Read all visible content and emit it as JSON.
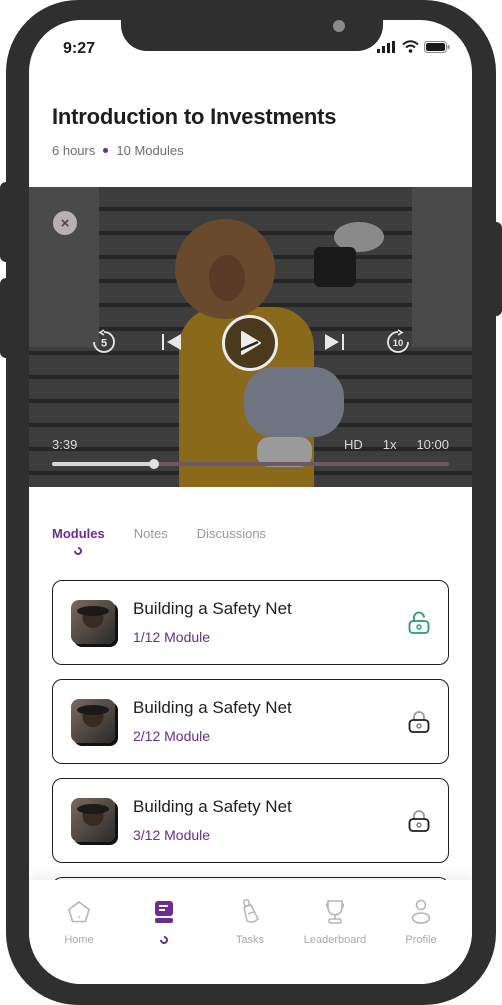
{
  "status_bar": {
    "time": "9:27",
    "icons": [
      "signal-icon",
      "wifi-icon",
      "battery-icon"
    ]
  },
  "course": {
    "title": "Introduction to Investments",
    "duration": "6 hours",
    "modules_count": "10 Modules"
  },
  "player": {
    "close_icon": "×",
    "rewind_label": "5",
    "forward_label": "10",
    "current_time": "3:39",
    "quality": "HD",
    "speed": "1x",
    "total_time": "10:00",
    "progress_fraction": 0.258
  },
  "tabs": [
    {
      "label": "Modules",
      "active": true
    },
    {
      "label": "Notes",
      "active": false
    },
    {
      "label": "Discussions",
      "active": false
    }
  ],
  "modules": [
    {
      "title": "Building a Safety Net",
      "subtitle": "1/12 Module",
      "lock_state": "unlocked"
    },
    {
      "title": "Building a Safety Net",
      "subtitle": "2/12 Module",
      "lock_state": "locked"
    },
    {
      "title": "Building a Safety Net",
      "subtitle": "3/12 Module",
      "lock_state": "locked"
    }
  ],
  "bottom_nav": [
    {
      "label": "Home",
      "icon": "home-icon",
      "active": false
    },
    {
      "label": "",
      "icon": "courses-icon",
      "active": true
    },
    {
      "label": "Tasks",
      "icon": "tasks-icon",
      "active": false
    },
    {
      "label": "Leaderboard",
      "icon": "trophy-icon",
      "active": false
    },
    {
      "label": "Profile",
      "icon": "profile-icon",
      "active": false
    }
  ],
  "colors": {
    "accent": "#6c2c91",
    "unlocked": "#2a9a6a",
    "text": "#1e1e1e",
    "muted": "#9a9a9a"
  }
}
